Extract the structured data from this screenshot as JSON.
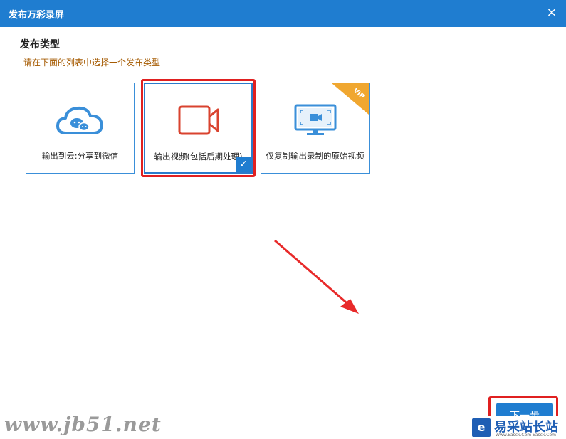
{
  "window": {
    "title": "发布万彩录屏",
    "close_label": "×"
  },
  "page": {
    "heading": "发布类型",
    "subtitle": "请在下面的列表中选择一个发布类型"
  },
  "options": [
    {
      "label": "输出到云:分享到微信",
      "icon": "cloud-wechat-icon",
      "selected": false
    },
    {
      "label": "输出视频(包括后期处理)",
      "icon": "video-camera-icon",
      "selected": true
    },
    {
      "label": "仅复制输出录制的原始视频",
      "icon": "monitor-video-icon",
      "selected": false,
      "badge": "VIP"
    }
  ],
  "footer": {
    "next_label": "下一步"
  },
  "watermarks": {
    "left": "www.jb51.net",
    "right_logo": "e",
    "right_brand": "易采站长站",
    "right_sub": "Www.Easck.Com Easck.Com"
  },
  "colors": {
    "accent": "#1f7dd0",
    "highlight": "#e02020",
    "vip": "#f0a730",
    "camera": "#d9432f"
  }
}
